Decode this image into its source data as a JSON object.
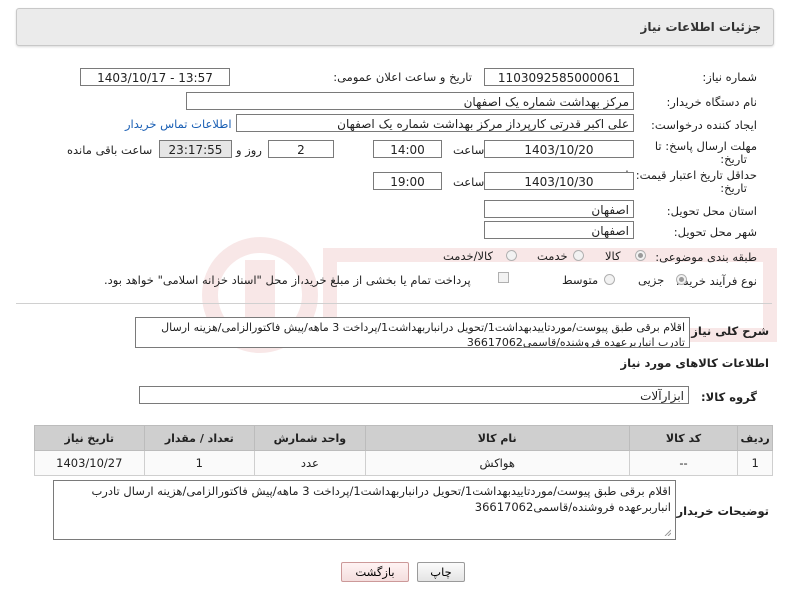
{
  "header": {
    "title": "جزئیات اطلاعات نیاز"
  },
  "need": {
    "number_label": "شماره نیاز:",
    "number": "1103092585000061",
    "announce_label": "تاریخ و ساعت اعلان عمومی:",
    "announce_value": "1403/10/17 - 13:57",
    "buyer_label": "نام دستگاه خریدار:",
    "buyer": "مرکز بهداشت شماره یک اصفهان",
    "creator_label": "ایجاد کننده درخواست:",
    "creator": "علی اکبر قدرتی کارپرداز مرکز بهداشت شماره یک اصفهان",
    "contact_link": "اطلاعات تماس خریدار",
    "deadline_label_1": "مهلت ارسال پاسخ: تا",
    "deadline_label_2": "تاریخ:",
    "deadline_date": "1403/10/20",
    "time_label": "ساعت",
    "deadline_time": "14:00",
    "days_value": "2",
    "days_label": "روز و",
    "remaining_time": "23:17:55",
    "remaining_label": "ساعت باقی مانده",
    "validity_label_1": "حداقل تاریخ اعتبار قیمت: تا",
    "validity_label_2": "تاریخ:",
    "validity_date": "1403/10/30",
    "validity_time": "19:00",
    "province_label": "استان محل تحویل:",
    "province": "اصفهان",
    "city_label": "شهر محل تحویل:",
    "city": "اصفهان",
    "category_label": "طبقه بندی موضوعی:",
    "category_options": [
      "کالا",
      "خدمت",
      "کالا/خدمت"
    ],
    "process_label": "نوع فرآیند خرید :",
    "process_options": [
      "جزیی",
      "متوسط"
    ],
    "treasury_note": "پرداخت تمام یا بخشی از مبلغ خرید،از محل \"اسناد خزانه اسلامی\" خواهد بود.",
    "summary_label": "شرح کلی نیاز:",
    "summary": "اقلام برقی طبق پیوست/موردتاییدبهداشت1/تحویل درانباربهداشت1/پرداخت 3 ماهه/پیش فاکتورالزامی/هزینه ارسال تادرب انباربرعهده فروشنده/قاسمی36617062"
  },
  "goods": {
    "section_title": "اطلاعات کالاهای مورد نیاز",
    "group_label": "گروه کالا:",
    "group_value": "ابزارآلات",
    "columns": [
      "ردیف",
      "کد کالا",
      "نام کالا",
      "واحد شمارش",
      "تعداد / مقدار",
      "تاریخ نیاز"
    ],
    "rows": [
      {
        "row": "1",
        "code": "--",
        "name": "هواکش",
        "unit": "عدد",
        "qty": "1",
        "date": "1403/10/27"
      }
    ]
  },
  "buyer_notes": {
    "label": "توضیحات خریدار:",
    "text": "اقلام برقی طبق پیوست/موردتاییدبهداشت1/تحویل درانباربهداشت1/پرداخت 3 ماهه/پیش فاکتورالزامی/هزینه ارسال تادرب انباربرعهده فروشنده/قاسمی36617062"
  },
  "buttons": {
    "print": "چاپ",
    "back": "بازگشت"
  },
  "colors": {
    "link": "#1a5fb4",
    "table_header": "#cfcfcf",
    "panel": "#ebebeb"
  }
}
